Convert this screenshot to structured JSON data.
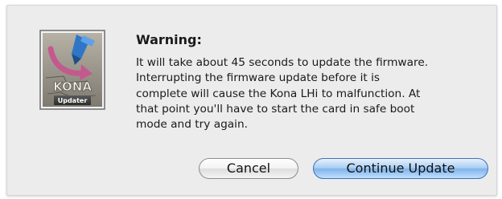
{
  "dialog": {
    "title": "Warning:",
    "message_lines": [
      "It will take about 45 seconds to update the firmware.",
      "Interrupting the firmware update before it is",
      "complete will cause the Kona LHi to malfunction. At",
      "that point you'll have to start the card in safe boot",
      "mode and try again."
    ]
  },
  "app_icon": {
    "name": "kona-updater-icon",
    "logo_text": "KONA",
    "caption": "Updater"
  },
  "buttons": {
    "cancel_label": "Cancel",
    "continue_label": "Continue Update"
  },
  "colors": {
    "dialog_bg": "#ececec",
    "default_button": "#8fc0f0",
    "accent_blue": "#3f72b3"
  }
}
